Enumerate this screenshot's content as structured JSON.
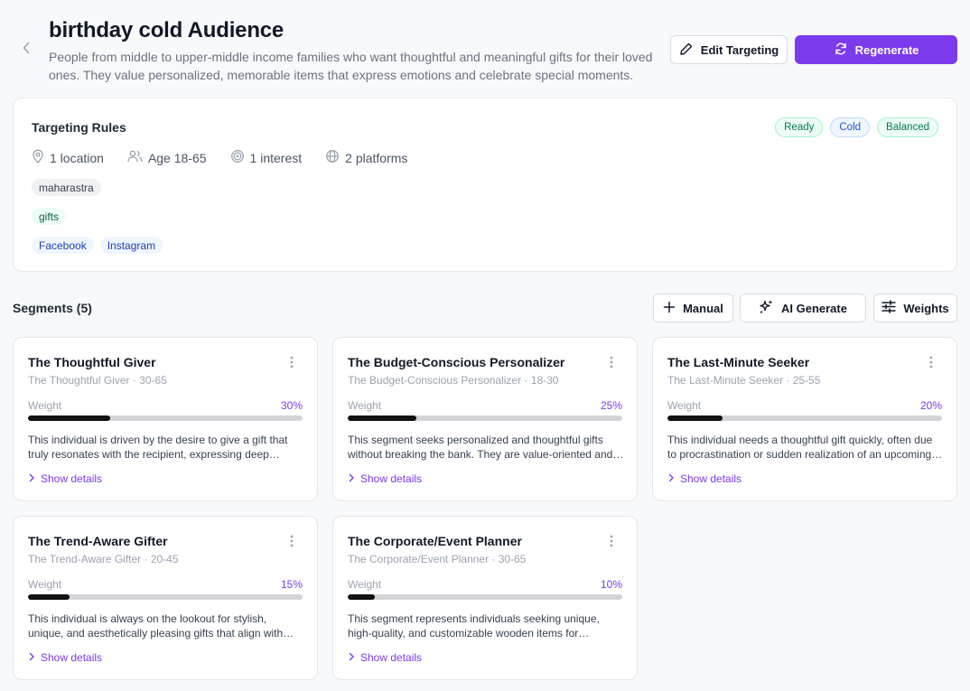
{
  "header": {
    "title": "birthday cold Audience",
    "subtitle": "People from middle to upper-middle income families who want thoughtful and meaningful gifts for their loved ones. They value personalized, memorable items that express emotions and celebrate special moments.",
    "edit_label": "Edit Targeting",
    "regenerate_label": "Regenerate"
  },
  "targeting": {
    "title": "Targeting Rules",
    "badges": [
      "Ready",
      "Cold",
      "Balanced"
    ],
    "stats": {
      "locations": "1 location",
      "age": "Age 18-65",
      "interests": "1 interest",
      "platforms": "2 platforms"
    },
    "locations": [
      "maharastra"
    ],
    "interests": [
      "gifts"
    ],
    "platforms": [
      "Facebook",
      "Instagram"
    ]
  },
  "segments_header": {
    "title": "Segments (5)",
    "manual_label": "Manual",
    "ai_label": "AI Generate",
    "weights_label": "Weights"
  },
  "segments": [
    {
      "name": "The Thoughtful Giver",
      "subtitle": "The Thoughtful Giver · 30-65",
      "weight_label": "Weight",
      "weight_text": "30%",
      "weight": 0.3,
      "description": "This individual is driven by the desire to give a gift that truly resonates with the recipient, expressing deep emotion and care.",
      "details_label": "Show details"
    },
    {
      "name": "The Budget-Conscious Personalizer",
      "subtitle": "The Budget-Conscious Personalizer · 18-30",
      "weight_label": "Weight",
      "weight_text": "25%",
      "weight": 0.25,
      "description": "This segment seeks personalized and thoughtful gifts without breaking the bank. They are value-oriented and practical.",
      "details_label": "Show details"
    },
    {
      "name": "The Last-Minute Seeker",
      "subtitle": "The Last-Minute Seeker · 25-55",
      "weight_label": "Weight",
      "weight_text": "20%",
      "weight": 0.2,
      "description": "This individual needs a thoughtful gift quickly, often due to procrastination or sudden realization of an upcoming occasion.",
      "details_label": "Show details"
    },
    {
      "name": "The Trend-Aware Gifter",
      "subtitle": "The Trend-Aware Gifter · 20-45",
      "weight_label": "Weight",
      "weight_text": "15%",
      "weight": 0.15,
      "description": "This individual is always on the lookout for stylish, unique, and aesthetically pleasing gifts that align with current trends.",
      "details_label": "Show details"
    },
    {
      "name": "The Corporate/Event Planner",
      "subtitle": "The Corporate/Event Planner · 30-65",
      "weight_label": "Weight",
      "weight_text": "10%",
      "weight": 0.1,
      "description": "This segment represents individuals seeking unique, high-quality, and customizable wooden items for corporate gifting and events.",
      "details_label": "Show details"
    }
  ],
  "colors": {
    "accent": "#7c3aed",
    "bar_fill": "#111111",
    "bar_track": "#d4d4d8"
  },
  "icons": {
    "back": "chevron-left-icon",
    "edit": "pencil-icon",
    "regenerate": "refresh-icon",
    "location": "map-pin-icon",
    "age": "users-icon",
    "interest": "target-icon",
    "platforms": "globe-icon",
    "manual": "plus-icon",
    "ai": "sparkles-icon",
    "weights": "sliders-icon",
    "menu": "more-vertical-icon",
    "details": "chevron-right-icon"
  }
}
